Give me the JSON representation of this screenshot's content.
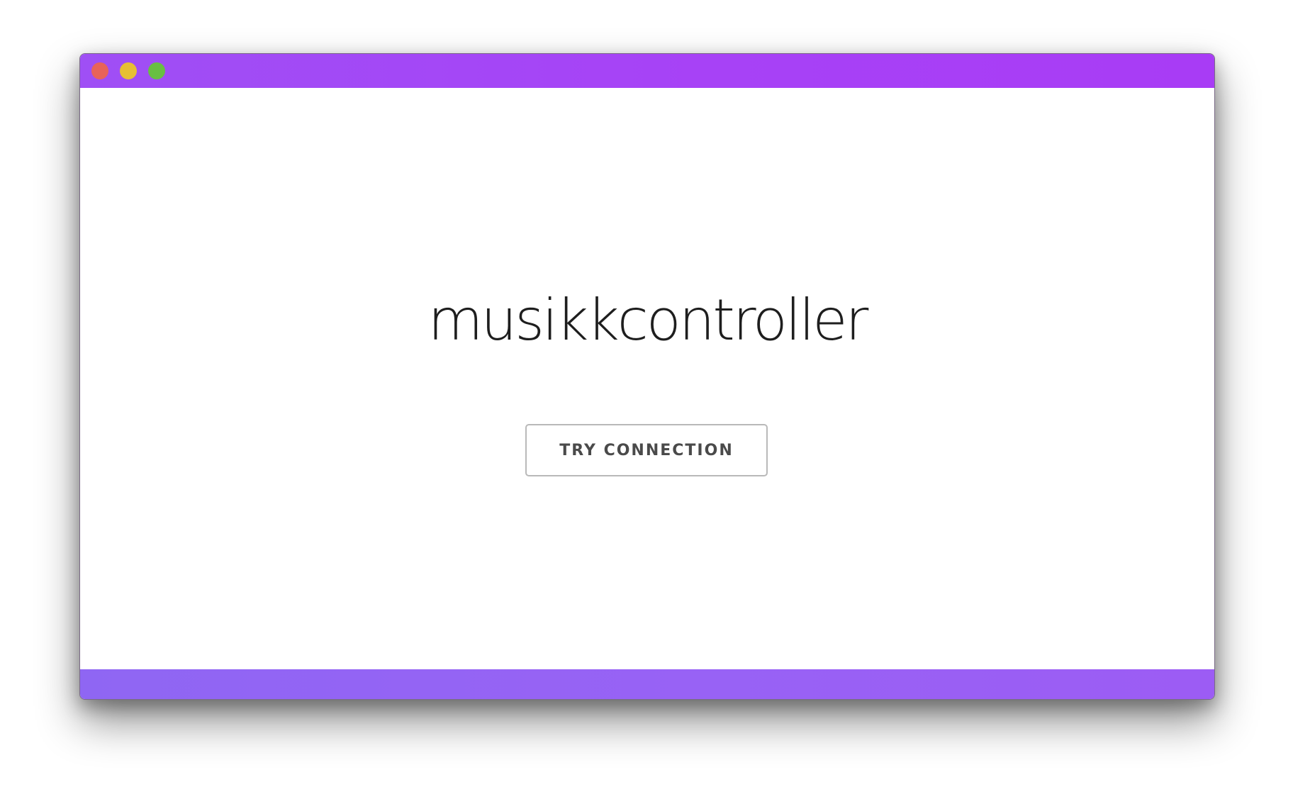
{
  "window": {
    "controls": {
      "close_color": "#e8635a",
      "minimize_color": "#e7bf33",
      "maximize_color": "#68bf42"
    },
    "titlebar_color": "#a742f6",
    "footer_color": "#9862f5"
  },
  "main": {
    "app_title": "musikkcontroller",
    "try_connection_label": "TRY CONNECTION"
  }
}
